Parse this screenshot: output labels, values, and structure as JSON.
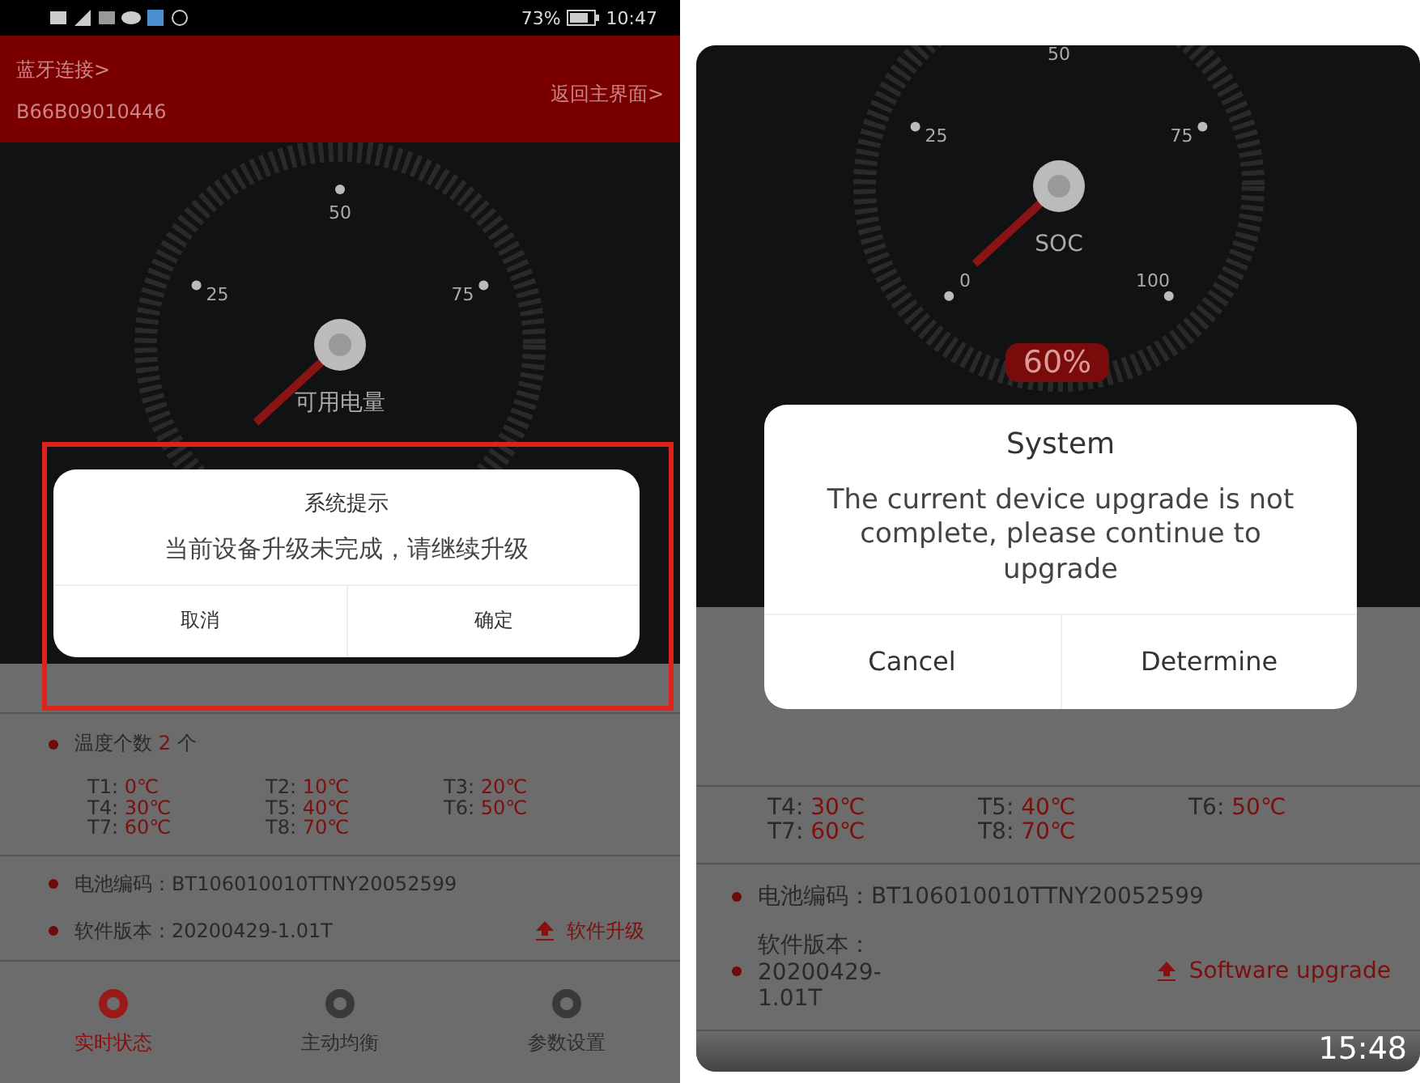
{
  "phones": [
    {
      "status_bar": {
        "battery": "73%",
        "time": "10:47"
      },
      "header": {
        "link": "蓝牙连接>",
        "device": "B66B09010446",
        "back": "返回主界面>"
      },
      "gauge": {
        "ticks": [
          "25",
          "50",
          "75"
        ],
        "label": "可用电量"
      },
      "dialog": {
        "title": "系统提示",
        "message": "当前设备升级未完成，请继续升级",
        "highlighted": true,
        "buttons": [
          {
            "label": "取消"
          },
          {
            "label": "确定"
          }
        ]
      },
      "temperatures": {
        "count_label": "温度个数",
        "count": "2",
        "count_unit": "个",
        "readings": [
          {
            "name": "T1:",
            "value": "0℃"
          },
          {
            "name": "T2:",
            "value": "10℃"
          },
          {
            "name": "T3:",
            "value": "20℃"
          },
          {
            "name": "T4:",
            "value": "30℃"
          },
          {
            "name": "T5:",
            "value": "40℃"
          },
          {
            "name": "T6:",
            "value": "50℃"
          },
          {
            "name": "T7:",
            "value": "60℃"
          },
          {
            "name": "T8:",
            "value": "70℃"
          }
        ]
      },
      "info": [
        {
          "label": "电池编码：",
          "value": "BT106010010TTNY20052599"
        },
        {
          "label": "软件版本：",
          "value": "20200429-1.01T"
        }
      ],
      "upgrade_link": "软件升级",
      "tabs": [
        {
          "label": "实时状态",
          "selected": true
        },
        {
          "label": "主动均衡",
          "selected": false
        },
        {
          "label": "参数设置",
          "selected": false
        }
      ]
    },
    {
      "gauge": {
        "ticks": [
          "0",
          "25",
          "50",
          "75",
          "100"
        ],
        "label": "SOC",
        "reading": "60%"
      },
      "dialog": {
        "title": "System",
        "message": "The current device upgrade is not complete, please continue to upgrade",
        "highlighted": false,
        "buttons": [
          {
            "label": "Cancel"
          },
          {
            "label": "Determine"
          }
        ]
      },
      "temperatures": {
        "readings": [
          {
            "name": "T4:",
            "value": "30℃"
          },
          {
            "name": "T5:",
            "value": "40℃"
          },
          {
            "name": "T6:",
            "value": "50℃"
          },
          {
            "name": "T7:",
            "value": "60℃"
          },
          {
            "name": "T8:",
            "value": "70℃"
          }
        ]
      },
      "info": [
        {
          "label": "电池编码：",
          "value": "BT106010010TTNY20052599"
        },
        {
          "label": "软件版本：",
          "value": "20200429-1.01T",
          "wrapped": true
        }
      ],
      "upgrade_link": "Software upgrade",
      "clock": "15:48"
    }
  ]
}
